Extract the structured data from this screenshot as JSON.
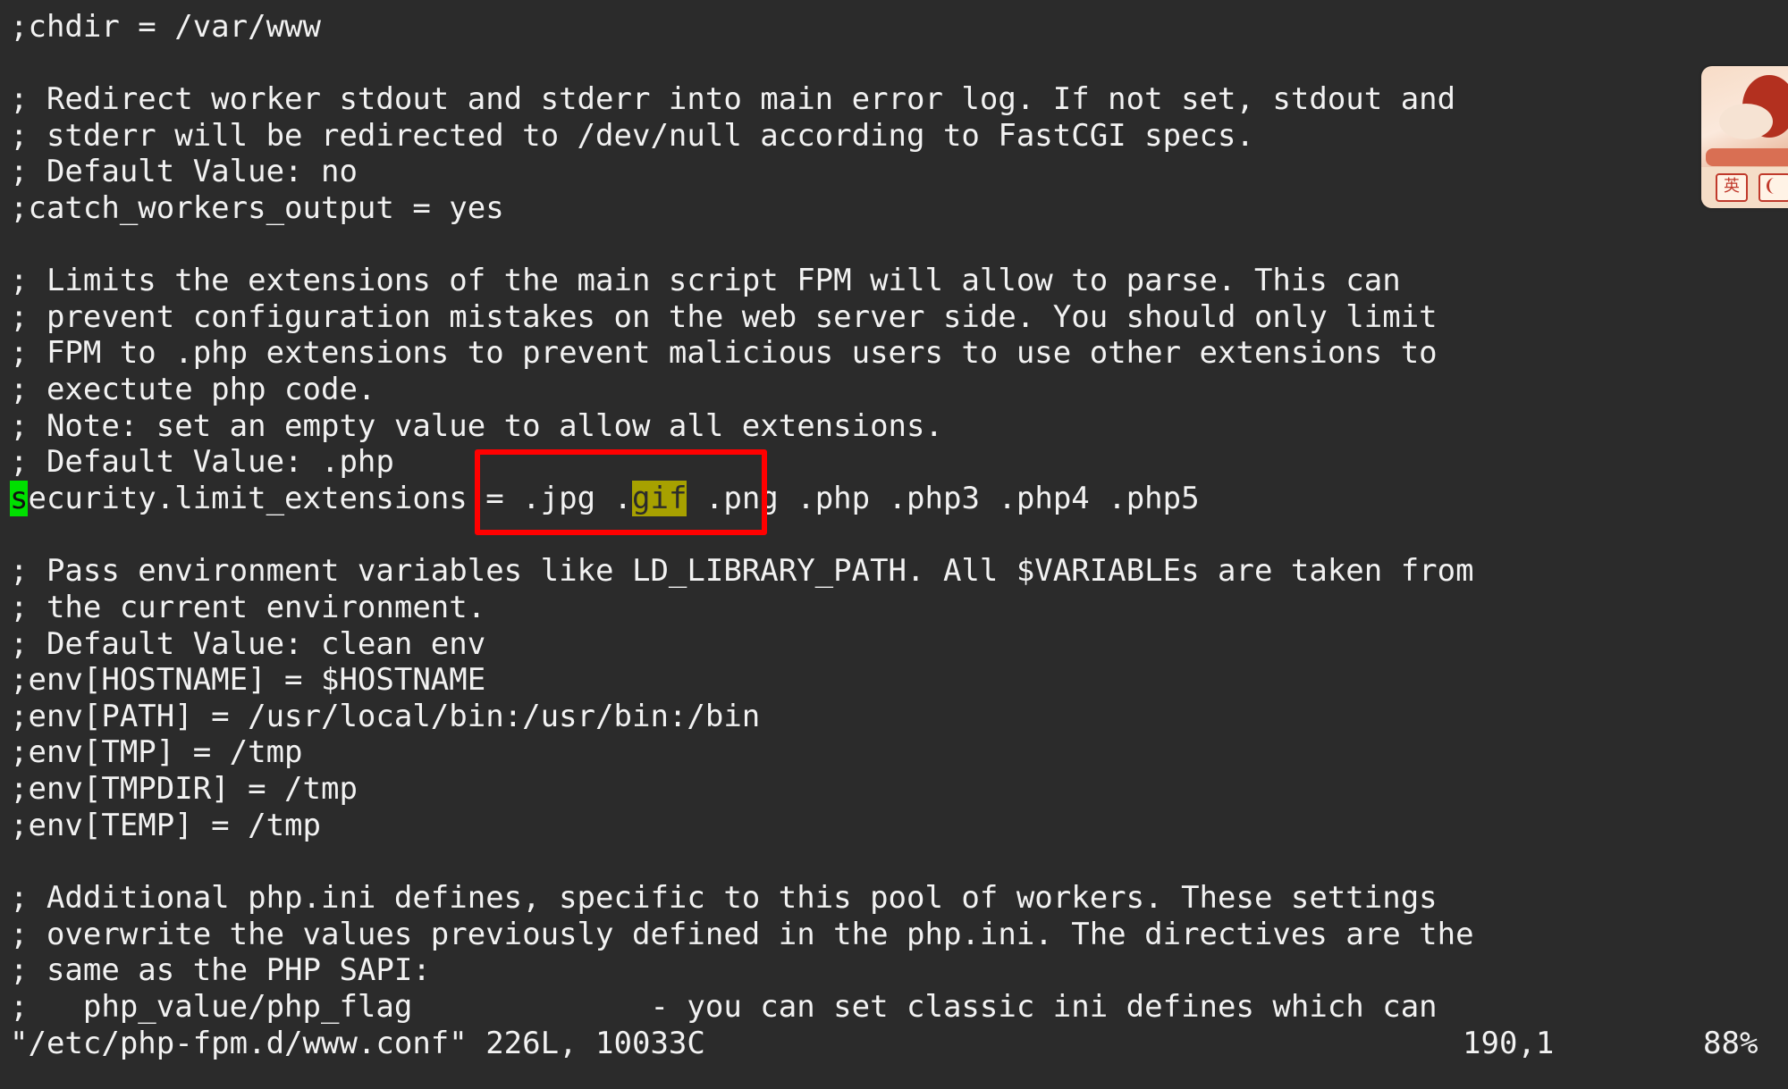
{
  "editor": {
    "lines": [
      ";chdir = /var/www",
      "",
      "; Redirect worker stdout and stderr into main error log. If not set, stdout and",
      "; stderr will be redirected to /dev/null according to FastCGI specs.",
      "; Default Value: no",
      ";catch_workers_output = yes",
      "",
      "; Limits the extensions of the main script FPM will allow to parse. This can",
      "; prevent configuration mistakes on the web server side. You should only limit",
      "; FPM to .php extensions to prevent malicious users to use other extensions to",
      "; exectute php code.",
      "; Note: set an empty value to allow all extensions.",
      "; Default Value: .php"
    ],
    "cursor_line": {
      "cursor_char": "s",
      "before_match": "ecurity.limit_extensions = .jpg .",
      "match": "gif",
      "after_match": " .png .php .php3 .php4 .php5"
    },
    "lines_after": [
      "",
      "; Pass environment variables like LD_LIBRARY_PATH. All $VARIABLEs are taken from",
      "; the current environment.",
      "; Default Value: clean env",
      ";env[HOSTNAME] = $HOSTNAME",
      ";env[PATH] = /usr/local/bin:/usr/bin:/bin",
      ";env[TMP] = /tmp",
      ";env[TMPDIR] = /tmp",
      ";env[TEMP] = /tmp",
      "",
      "; Additional php.ini defines, specific to this pool of workers. These settings",
      "; overwrite the values previously defined in the php.ini. The directives are the",
      "; same as the PHP SAPI:",
      ";   php_value/php_flag             - you can set classic ini defines which can"
    ],
    "colors": {
      "background": "#2b2b2b",
      "text": "#f2f2f2",
      "cursor": "#00e000",
      "search_highlight": "#a7a100",
      "annotation_box": "#ff0000"
    }
  },
  "status_bar": {
    "file_info": "\"/etc/php-fpm.d/www.conf\" 226L, 10033C",
    "position": "190,1",
    "percent": "88%"
  },
  "ime_widget": {
    "lang_label": "英",
    "moon_icon": "moon-icon"
  }
}
